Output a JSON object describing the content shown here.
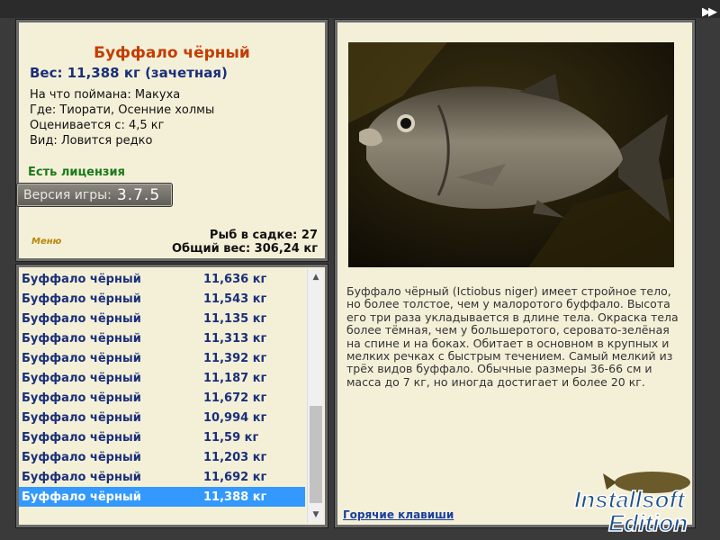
{
  "fish": {
    "name": "Буффало чёрный",
    "weight_line": "Вес: 11,388 кг (зачетная)",
    "caught_on": "На что поймана: Макуха",
    "location": "Где: Тиорати, Осенние холмы",
    "rated_from": "Оценивается с: 4,5 кг",
    "species_note": "Вид: Ловится редко",
    "license": "Есть лицензия"
  },
  "version": {
    "label": "Версия игры:",
    "number": "3.7.5"
  },
  "keepnet": {
    "count_line": "Рыб в садке: 27",
    "total_line": "Общий вес: 306,24 кг"
  },
  "menu_label": "Меню",
  "catch_list": [
    {
      "name": "Буффало чёрный",
      "weight": "11,636 кг"
    },
    {
      "name": "Буффало чёрный",
      "weight": "11,543 кг"
    },
    {
      "name": "Буффало чёрный",
      "weight": "11,135 кг"
    },
    {
      "name": "Буффало чёрный",
      "weight": "11,313 кг"
    },
    {
      "name": "Буффало чёрный",
      "weight": "11,392 кг"
    },
    {
      "name": "Буффало чёрный",
      "weight": "11,187 кг"
    },
    {
      "name": "Буффало чёрный",
      "weight": "11,672 кг"
    },
    {
      "name": "Буффало чёрный",
      "weight": "10,994 кг"
    },
    {
      "name": "Буффало чёрный",
      "weight": "11,59 кг"
    },
    {
      "name": "Буффало чёрный",
      "weight": "11,203 кг"
    },
    {
      "name": "Буффало чёрный",
      "weight": "11,692 кг"
    },
    {
      "name": "Буффало чёрный",
      "weight": "11,388 кг",
      "selected": true
    }
  ],
  "description": "Буффало чёрный (Ictiobus niger) имеет стройное тело, но более толстое, чем у малоротого буффало. Высота его три раза укладывается в длине тела. Окраска тела более тёмная, чем у большеротого, серовато-зелёная на спине и на боках. Обитает в основном в крупных и мелких речках с быстрым течением. Самый мелкий из трёх видов буффало. Обычные размеры 36-66 см и масса до 7 кг, но иногда достигает и более 20 кг.",
  "hotkeys_link": "Горячие клавиши",
  "watermark": {
    "line1": "Installsoft",
    "line2": "Edition"
  },
  "icons": {
    "fast_forward": "fast-forward-icon",
    "scroll_up": "scroll-up-icon",
    "scroll_down": "scroll-down-icon"
  },
  "colors": {
    "title": "#c43c00",
    "weight": "#1a2f7a",
    "license": "#1a7a1a",
    "selection": "#3399ff",
    "panel": "#f4f0d8"
  }
}
